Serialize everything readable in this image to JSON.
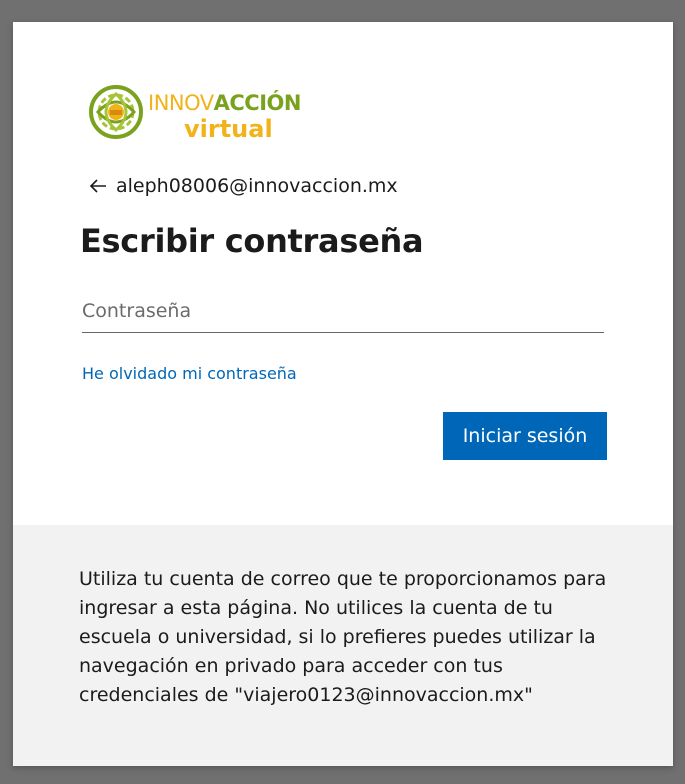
{
  "logo": {
    "text_part1": "INNOV",
    "text_part2": "ACCIÓN",
    "text_bottom": "virtual",
    "colors": {
      "gold": "#f2b31a",
      "green": "#7aa21e"
    },
    "icon": "knot-emblem-icon"
  },
  "identity": {
    "back_icon": "arrow-left-icon",
    "email": "aleph08006@innovaccion.mx"
  },
  "form": {
    "title": "Escribir contraseña",
    "password_placeholder": "Contraseña",
    "password_value": "",
    "forgot_link": "He olvidado mi contraseña",
    "submit_label": "Iniciar sesión"
  },
  "footer": {
    "message": "Utiliza tu cuenta de correo que te proporcionamos para ingresar a esta página. No utilices la cuenta de tu escuela o universidad, si lo prefieres puedes utilizar la navegación en privado para acceder con tus credenciales de \"viajero0123@innovaccion.mx\""
  },
  "colors": {
    "backdrop": "#707070",
    "card": "#ffffff",
    "footer_bg": "#f2f2f2",
    "accent": "#0067b8",
    "text": "#1b1b1b"
  }
}
